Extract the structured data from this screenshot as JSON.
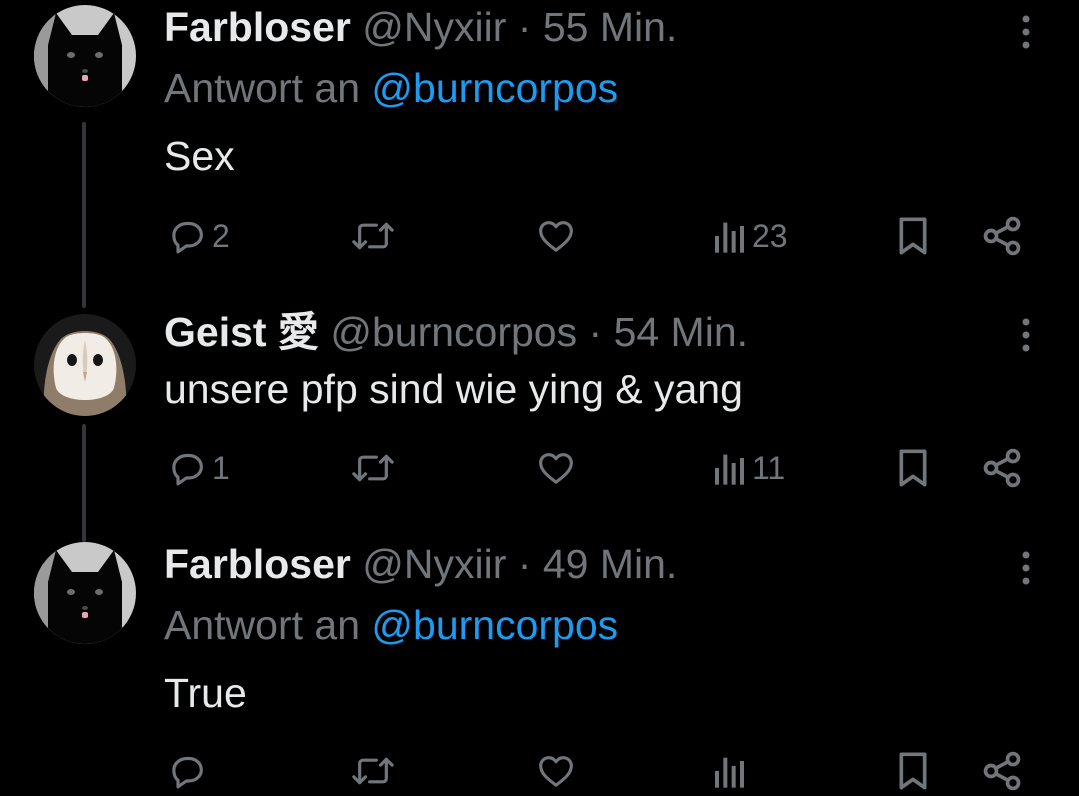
{
  "tweets": [
    {
      "name": "Farbloser",
      "handle": "@Nyxiir",
      "separator": "·",
      "time": "55 Min.",
      "reply_prefix": "Antwort an",
      "reply_to": "@burncorpos",
      "text": "Sex",
      "avatar": "black-cat-avatar",
      "stats": {
        "replies": "2",
        "views": "23"
      }
    },
    {
      "name": "Geist 愛",
      "handle": "@burncorpos",
      "separator": "·",
      "time": "54 Min.",
      "text": "unsere pfp sind wie ying & yang",
      "avatar": "white-owl-avatar",
      "stats": {
        "replies": "1",
        "views": "11"
      }
    },
    {
      "name": "Farbloser",
      "handle": "@Nyxiir",
      "separator": "·",
      "time": "49 Min.",
      "reply_prefix": "Antwort an",
      "reply_to": "@burncorpos",
      "text": "True",
      "avatar": "black-cat-avatar"
    }
  ],
  "icons": {
    "reply": "speech-bubble-icon",
    "retweet": "retweet-icon",
    "like": "heart-icon",
    "views": "bar-chart-icon",
    "bookmark": "bookmark-icon",
    "share": "share-icon",
    "more": "vertical-dots-icon"
  },
  "colors": {
    "background": "#000000",
    "text": "#e7e9ea",
    "muted": "#71767b",
    "link": "#1d9bf0",
    "thread_line": "#333639"
  }
}
